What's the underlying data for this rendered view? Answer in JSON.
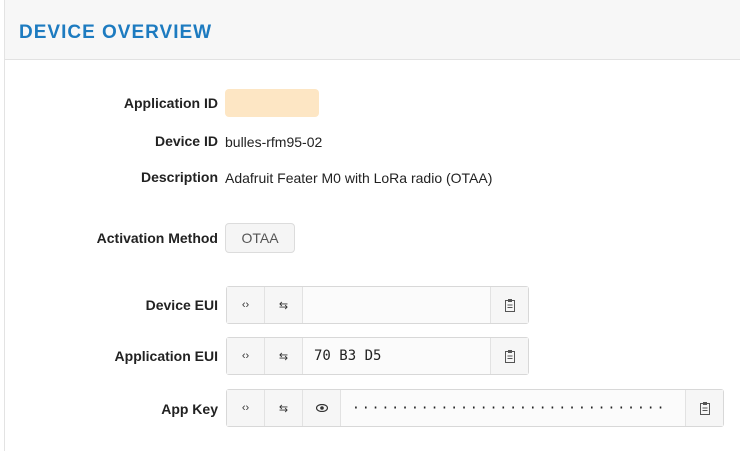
{
  "header": {
    "title": "DEVICE OVERVIEW"
  },
  "fields": {
    "application_id": {
      "label": "Application ID",
      "value": ""
    },
    "device_id": {
      "label": "Device ID",
      "value": "bulles-rfm95-02"
    },
    "description": {
      "label": "Description",
      "value": "Adafruit Feater M0 with LoRa radio (OTAA)"
    },
    "activation_method": {
      "label": "Activation Method",
      "value": "OTAA"
    },
    "device_eui": {
      "label": "Device EUI",
      "value": ""
    },
    "application_eui": {
      "label": "Application EUI",
      "value": "70 B3 D5"
    },
    "app_key": {
      "label": "App Key",
      "value": "································"
    }
  },
  "icons": {
    "code": "‹›",
    "swap": "⇆",
    "eye": "👁",
    "clipboard": "clipboard-icon"
  },
  "colors": {
    "accent": "#1d7bc0",
    "app_id_highlight": "#fde6c4",
    "header_bg": "#f7f7f7"
  }
}
